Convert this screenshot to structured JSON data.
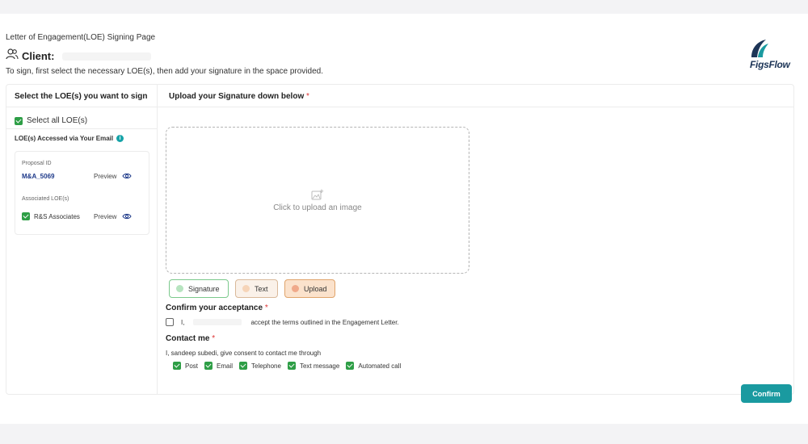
{
  "header": {
    "page_title": "Letter of Engagement(LOE) Signing Page",
    "client_label": "Client:",
    "instructions": "To sign, first select the necessary LOE(s), then add your signature in the space provided.",
    "logo_text": "FigsFlow"
  },
  "left_panel": {
    "heading": "Select the LOE(s) you want to sign",
    "select_all_label": "Select all LOE(s)",
    "select_all_checked": true,
    "accessed_label": "LOE(s) Accessed via Your Email",
    "info_icon": "i",
    "proposal_id_label": "Proposal ID",
    "proposal_id": "M&A_5069",
    "associated_label": "Associated LOE(s)",
    "associated_items": [
      {
        "name": "R&S Associates",
        "checked": true
      }
    ],
    "preview_label": "Preview"
  },
  "right_panel": {
    "heading": "Upload your Signature down below",
    "required_mark": "*",
    "upload_placeholder": "Click to upload an image",
    "tabs": [
      {
        "label": "Signature",
        "color": "#b7e4c0",
        "border": "#7bc98c",
        "bg": "#ffffff"
      },
      {
        "label": "Text",
        "color": "#f6d4b8",
        "border": "#d9b99a",
        "bg": "#faf1e9"
      },
      {
        "label": "Upload",
        "color": "#f0a98a",
        "border": "#e0a46c",
        "bg": "#fbe2cc"
      }
    ],
    "confirm_title": "Confirm your acceptance",
    "accept_prefix": "I,",
    "accept_suffix": "accept the terms outlined in the Engagement Letter.",
    "accept_checked": false,
    "contact_title": "Contact me",
    "consent_text": "I, sandeep subedi, give consent to contact me through",
    "contact_options": [
      {
        "label": "Post",
        "checked": true
      },
      {
        "label": "Email",
        "checked": true
      },
      {
        "label": "Telephone",
        "checked": true
      },
      {
        "label": "Text message",
        "checked": true
      },
      {
        "label": "Automated call",
        "checked": true
      }
    ],
    "confirm_button": "Confirm"
  },
  "colors": {
    "accent": "#1a9aa0",
    "checkbox_green": "#2e9e46",
    "logo_blue": "#1d3557",
    "logo_teal": "#1a9aa0"
  }
}
